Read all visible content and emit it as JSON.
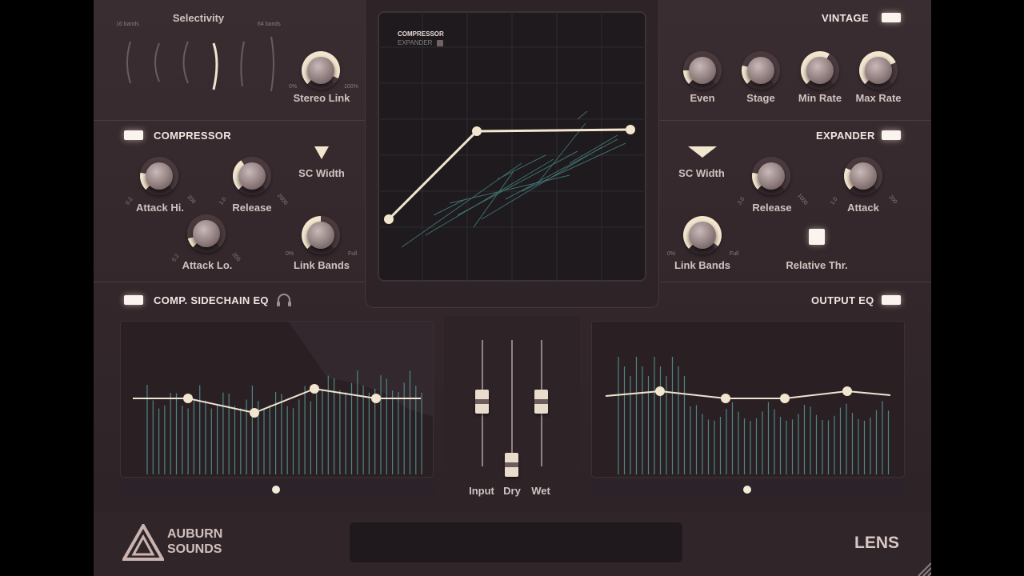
{
  "colors": {
    "accent": "#f3e6cf",
    "panel": "#2a2024",
    "background": "#33272b",
    "teal": "#4f8e8c"
  },
  "top": {
    "selectivity_label": "Selectivity",
    "selectivity_min": "16 bands",
    "selectivity_max": "64 bands",
    "stereo_link": {
      "label": "Stereo Link",
      "min": "0%",
      "max": "100%"
    },
    "vintage_label": "VINTAGE",
    "knobs": [
      {
        "label": "Even"
      },
      {
        "label": "Stage"
      },
      {
        "label": "Min Rate"
      },
      {
        "label": "Max Rate"
      }
    ]
  },
  "display": {
    "mode_top": "COMPRESSOR",
    "mode_bottom": "EXPANDER"
  },
  "compressor": {
    "title": "COMPRESSOR",
    "attack_hi": {
      "label": "Attack Hi.",
      "min": "0.2",
      "max": "200"
    },
    "release": {
      "label": "Release",
      "min": "1.0",
      "max": "2000"
    },
    "attack_lo": {
      "label": "Attack Lo.",
      "min": "0.2",
      "max": "200"
    },
    "link_bands": {
      "label": "Link Bands",
      "min": "0%",
      "max": "Full"
    },
    "sc_width": "SC Width"
  },
  "expander": {
    "title": "EXPANDER",
    "sc_width": "SC Width",
    "release": {
      "label": "Release",
      "min": "3.0",
      "max": "1000"
    },
    "attack": {
      "label": "Attack",
      "min": "1.0",
      "max": "200"
    },
    "link_bands": {
      "label": "Link Bands",
      "min": "0%",
      "max": "Full"
    },
    "relative_thr": "Relative Thr."
  },
  "sidechain_eq": {
    "title": "COMP. SIDECHAIN EQ"
  },
  "output_eq": {
    "title": "OUTPUT EQ"
  },
  "faders": [
    {
      "label": "Input"
    },
    {
      "label": "Dry"
    },
    {
      "label": "Wet"
    }
  ],
  "footer": {
    "brand_line1": "AUBURN",
    "brand_line2": "SOUNDS",
    "product": "LENS"
  }
}
